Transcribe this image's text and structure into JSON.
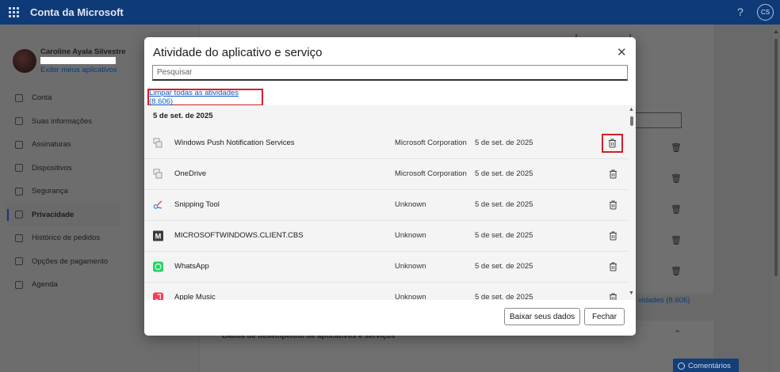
{
  "topbar": {
    "title": "Conta da Microsoft",
    "help": "?",
    "user_initials": "CS"
  },
  "sidebar": {
    "profile_name": "Caroline Ayala Silvestre",
    "profile_link": "Exibir meus aplicativos",
    "items": [
      {
        "label": "Conta",
        "icon": "home-icon"
      },
      {
        "label": "Suas informações",
        "icon": "person-icon"
      },
      {
        "label": "Assinaturas",
        "icon": "subscriptions-icon"
      },
      {
        "label": "Dispositivos",
        "icon": "laptop-icon"
      },
      {
        "label": "Segurança",
        "icon": "shield-icon"
      },
      {
        "label": "Privacidade",
        "icon": "lock-icon",
        "active": true
      },
      {
        "label": "Histórico de pedidos",
        "icon": "cart-icon"
      },
      {
        "label": "Opções de pagamento",
        "icon": "card-icon"
      },
      {
        "label": "Agenda",
        "icon": "location-icon"
      }
    ]
  },
  "background": {
    "link_partial": "vidades (8.606)",
    "section_title": "Dados de desempenho de aplicativos e serviços",
    "feedback": "Comentários"
  },
  "dialog": {
    "title": "Atividade do aplicativo e serviço",
    "search_placeholder": "Pesquisar",
    "clear_all": "Limpar todas as atividades (8.606)",
    "date_header": "5 de set. de 2025",
    "rows": [
      {
        "name": "Windows Push Notification Services",
        "publisher": "Microsoft Corporation",
        "date": "5 de set. de 2025",
        "icon": "generic-app-icon",
        "highlighted": true
      },
      {
        "name": "OneDrive",
        "publisher": "Microsoft Corporation",
        "date": "5 de set. de 2025",
        "icon": "generic-app-icon"
      },
      {
        "name": "Snipping Tool",
        "publisher": "Unknown",
        "date": "5 de set. de 2025",
        "icon": "snipping-tool-icon"
      },
      {
        "name": "MICROSOFTWINDOWS.CLIENT.CBS",
        "publisher": "Unknown",
        "date": "5 de set. de 2025",
        "icon": "m-letter-icon"
      },
      {
        "name": "WhatsApp",
        "publisher": "Unknown",
        "date": "5 de set. de 2025",
        "icon": "whatsapp-icon"
      },
      {
        "name": "Apple Music",
        "publisher": "Unknown",
        "date": "5 de set. de 2025",
        "icon": "apple-music-icon"
      }
    ],
    "download_button": "Baixar seus dados",
    "close_button": "Fechar"
  },
  "colors": {
    "topbar": "#0f3a78",
    "highlight_box": "#d1202b",
    "link": "#0b57c3"
  }
}
